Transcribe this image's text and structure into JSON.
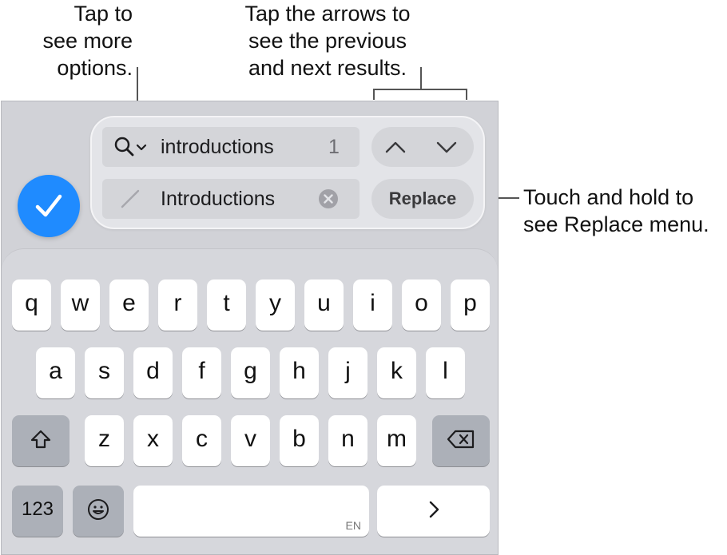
{
  "callouts": {
    "more_options": "Tap to\nsee more\noptions.",
    "arrows": "Tap the arrows to\nsee the previous\nand next results.",
    "replace_menu": "Touch and hold to\nsee Replace menu."
  },
  "find": {
    "search_text": "introductions",
    "match_count": "1"
  },
  "replace": {
    "text": "Introductions",
    "button_label": "Replace"
  },
  "keyboard": {
    "row1": [
      "q",
      "w",
      "e",
      "r",
      "t",
      "y",
      "u",
      "i",
      "o",
      "p"
    ],
    "row2": [
      "a",
      "s",
      "d",
      "f",
      "g",
      "h",
      "j",
      "k",
      "l"
    ],
    "row3": [
      "z",
      "x",
      "c",
      "v",
      "b",
      "n",
      "m"
    ],
    "numbers_label": "123",
    "language_label": "EN"
  },
  "colors": {
    "accent": "#1f8bff",
    "panel_bg": "#d1d2d7",
    "key_bg": "#ffffff",
    "fn_key_bg": "#acb0b8"
  },
  "icons": {
    "search": "search-icon",
    "chevron_down": "chevron-down-icon",
    "previous": "chevron-up-icon",
    "next": "chevron-down-icon",
    "pencil": "pencil-icon",
    "clear": "clear-circle-icon",
    "done": "checkmark-icon",
    "shift": "shift-icon",
    "delete": "backspace-icon",
    "emoji": "emoji-icon",
    "return": "chevron-right-icon"
  }
}
